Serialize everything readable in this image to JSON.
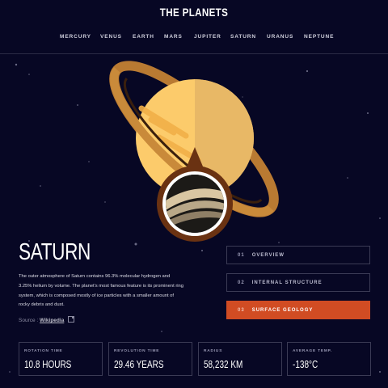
{
  "app": {
    "title": "THE PLANETS"
  },
  "nav": {
    "items": [
      "MERCURY",
      "VENUS",
      "EARTH",
      "MARS",
      "JUPITER",
      "SATURN",
      "URANUS",
      "NEPTUNE"
    ]
  },
  "planet": {
    "name": "SATURN",
    "description": "The outer atmosphere of Saturn contains 96.3% molecular hydrogen and 3.25% helium by volume. The planet's most famous feature is its prominent ring system, which is composed mostly of ice particles with a smaller amount of rocky debris and dust.",
    "source_label": "Source :",
    "source_link": "Wikipedia"
  },
  "tabs": [
    {
      "num": "01",
      "label": "OVERVIEW",
      "active": false
    },
    {
      "num": "02",
      "label": "INTERNAL STRUCTURE",
      "active": false
    },
    {
      "num": "03",
      "label": "SURFACE GEOLOGY",
      "active": true
    }
  ],
  "stats": [
    {
      "label": "ROTATION TIME",
      "value": "10.8 HOURS"
    },
    {
      "label": "REVOLUTION TIME",
      "value": "29.46 YEARS"
    },
    {
      "label": "RADIUS",
      "value": "58,232 KM"
    },
    {
      "label": "AVERAGE TEMP.",
      "value": "-138°C"
    }
  ],
  "colors": {
    "background": "#070724",
    "accent": "#D14C23",
    "border": "#3B3B55",
    "planet": "#FCCB6B",
    "ring": "#C98A3A"
  }
}
